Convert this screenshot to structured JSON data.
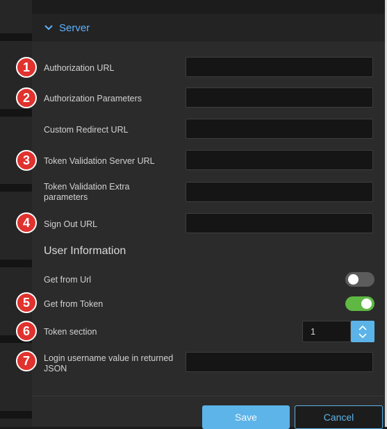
{
  "section": {
    "title": "Server"
  },
  "fields": [
    {
      "label": "Authorization URL",
      "value": ""
    },
    {
      "label": "Authorization Parameters",
      "value": ""
    },
    {
      "label": "Custom Redirect URL",
      "value": ""
    },
    {
      "label": "Token Validation Server URL",
      "value": ""
    },
    {
      "label": "Token Validation Extra parameters",
      "value": ""
    },
    {
      "label": "Sign Out URL",
      "value": ""
    }
  ],
  "user_information": {
    "title": "User Information",
    "get_from_url": {
      "label": "Get from Url",
      "enabled": false
    },
    "get_from_token": {
      "label": "Get from Token",
      "enabled": true
    },
    "token_section": {
      "label": "Token section",
      "value": "1"
    },
    "login_username": {
      "label": "Login username value in returned JSON",
      "value": ""
    }
  },
  "badges": [
    "1",
    "2",
    "3",
    "4",
    "5",
    "6",
    "7"
  ],
  "buttons": {
    "save": "Save",
    "cancel": "Cancel"
  },
  "colors": {
    "accent": "#5db4e9",
    "toggle_on": "#5fb844",
    "toggle_off": "#5c5c5c",
    "badge": "#e0322e"
  }
}
